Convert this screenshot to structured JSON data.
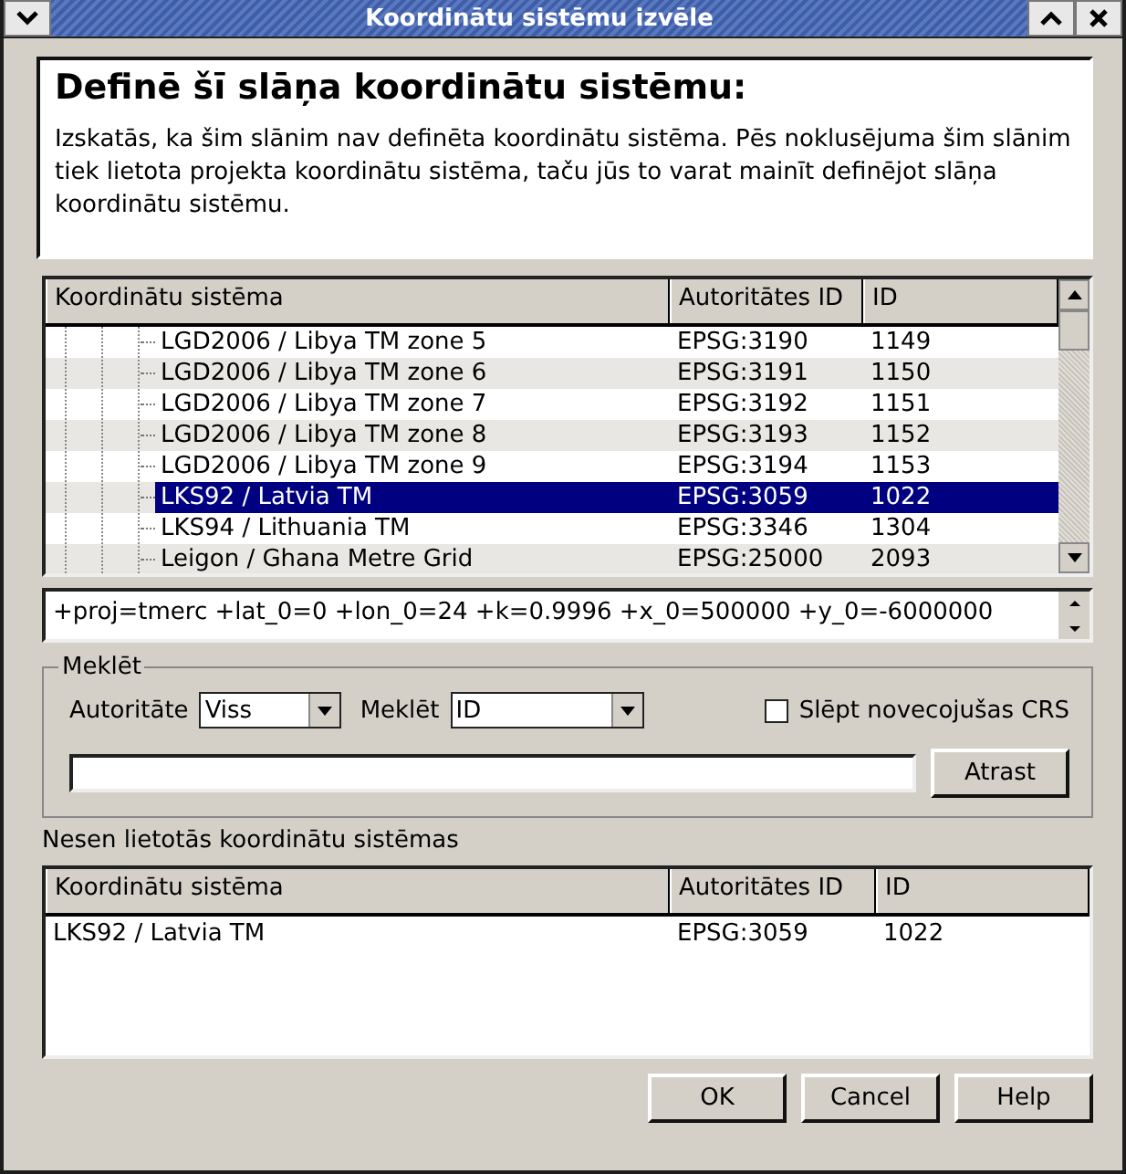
{
  "window": {
    "title": "Koordinātu sistēmu izvēle"
  },
  "info": {
    "heading": "Definē šī slāņa koordinātu sistēmu:",
    "text": "Izskatās, ka šim slānim nav definēta koordinātu sistēma. Pēs noklusējuma šim slānim tiek lietota projekta koordinātu sistēma, taču jūs to varat mainīt definējot slāņa koordinātu sistēmu."
  },
  "crs_table": {
    "columns": [
      "Koordinātu sistēma",
      "Autoritātes ID",
      "ID"
    ],
    "rows": [
      {
        "name": "LGD2006 / Libya TM zone 5",
        "auth_id": "EPSG:3190",
        "id": "1149",
        "selected": false
      },
      {
        "name": "LGD2006 / Libya TM zone 6",
        "auth_id": "EPSG:3191",
        "id": "1150",
        "selected": false
      },
      {
        "name": "LGD2006 / Libya TM zone 7",
        "auth_id": "EPSG:3192",
        "id": "1151",
        "selected": false
      },
      {
        "name": "LGD2006 / Libya TM zone 8",
        "auth_id": "EPSG:3193",
        "id": "1152",
        "selected": false
      },
      {
        "name": "LGD2006 / Libya TM zone 9",
        "auth_id": "EPSG:3194",
        "id": "1153",
        "selected": false
      },
      {
        "name": "LKS92 / Latvia TM",
        "auth_id": "EPSG:3059",
        "id": "1022",
        "selected": true
      },
      {
        "name": "LKS94 / Lithuania TM",
        "auth_id": "EPSG:3346",
        "id": "1304",
        "selected": false
      },
      {
        "name": "Leigon / Ghana Metre Grid",
        "auth_id": "EPSG:25000",
        "id": "2093",
        "selected": false
      }
    ]
  },
  "proj_string": "+proj=tmerc +lat_0=0 +lon_0=24 +k=0.9996 +x_0=500000 +y_0=-6000000",
  "search": {
    "legend": "Meklēt",
    "authority_label": "Autoritāte",
    "authority_value": "Viss",
    "search_label": "Meklēt",
    "search_value": "ID",
    "hide_deprecated": {
      "label": "Slēpt novecojušas CRS",
      "checked": false
    },
    "find_button": "Atrast"
  },
  "recent": {
    "label": "Nesen lietotās koordinātu sistēmas",
    "columns": [
      "Koordinātu sistēma",
      "Autoritātes ID",
      "ID"
    ],
    "rows": [
      {
        "name": "LKS92 / Latvia TM",
        "auth_id": "EPSG:3059",
        "id": "1022"
      }
    ]
  },
  "buttons": [
    "OK",
    "Cancel",
    "Help"
  ]
}
